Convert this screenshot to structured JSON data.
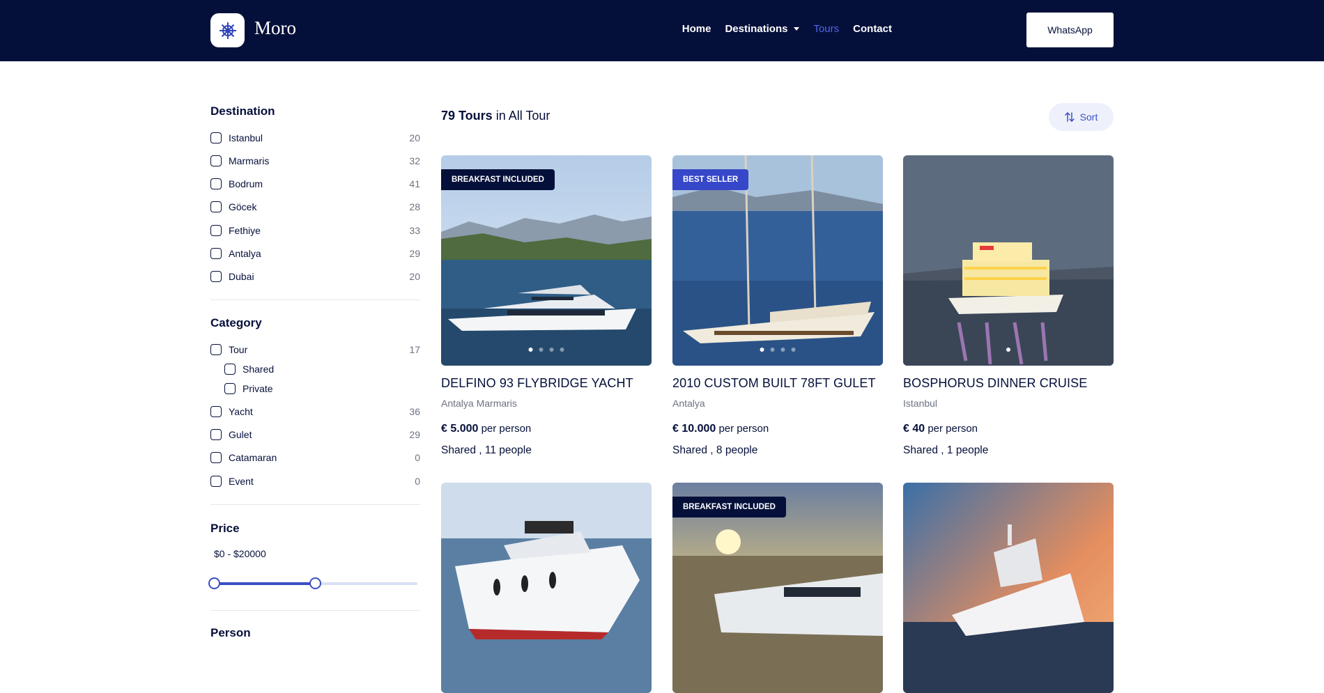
{
  "header": {
    "brand": "Moro",
    "nav": [
      "Home",
      "Destinations",
      "Tours",
      "Contact"
    ],
    "cta": "WhatsApp"
  },
  "sidebar": {
    "destination": {
      "title": "Destination",
      "items": [
        {
          "label": "Istanbul",
          "count": "20"
        },
        {
          "label": "Marmaris",
          "count": "32"
        },
        {
          "label": "Bodrum",
          "count": "41"
        },
        {
          "label": "Göcek",
          "count": "28"
        },
        {
          "label": "Fethiye",
          "count": "33"
        },
        {
          "label": "Antalya",
          "count": "29"
        },
        {
          "label": "Dubai",
          "count": "20"
        }
      ]
    },
    "category": {
      "title": "Category",
      "items": [
        {
          "label": "Tour",
          "count": "17"
        },
        {
          "label": "Shared",
          "count": ""
        },
        {
          "label": "Private",
          "count": ""
        },
        {
          "label": "Yacht",
          "count": "36"
        },
        {
          "label": "Gulet",
          "count": "29"
        },
        {
          "label": "Catamaran",
          "count": "0"
        },
        {
          "label": "Event",
          "count": "0"
        }
      ]
    },
    "price": {
      "title": "Price",
      "range": "$0 - $20000"
    },
    "person": {
      "title": "Person"
    }
  },
  "main": {
    "results_count": "79 Tours",
    "results_suffix": " in All Tour",
    "sort_label": "Sort",
    "tours": [
      {
        "title": "DELFINO 93 FLYBRIDGE YACHT",
        "location": "Antalya Marmaris",
        "price": "€ 5.000",
        "per": "per person",
        "meta": "Shared , 11 people",
        "badge": "BREAKFAST INCLUDED",
        "badge_style": "dark"
      },
      {
        "title": "2010 CUSTOM BUILT 78FT GULET",
        "location": "Antalya",
        "price": "€ 10.000",
        "per": "per person",
        "meta": "Shared , 8 people",
        "badge": "BEST SELLER",
        "badge_style": "blue"
      },
      {
        "title": "BOSPHORUS DINNER CRUISE",
        "location": "Istanbul",
        "price": "€ 40",
        "per": "per person",
        "meta": "Shared , 1 people",
        "badge": "",
        "badge_style": ""
      },
      {
        "title": "",
        "location": "",
        "price": "",
        "per": "",
        "meta": "",
        "badge": "",
        "badge_style": ""
      },
      {
        "title": "",
        "location": "",
        "price": "",
        "per": "",
        "meta": "",
        "badge": "BREAKFAST INCLUDED",
        "badge_style": "dark"
      },
      {
        "title": "",
        "location": "",
        "price": "",
        "per": "",
        "meta": "",
        "badge": "",
        "badge_style": ""
      }
    ]
  },
  "colors": {
    "navy": "#05103a",
    "accent": "#3b4fc4",
    "badge_blue": "#3647c9"
  }
}
